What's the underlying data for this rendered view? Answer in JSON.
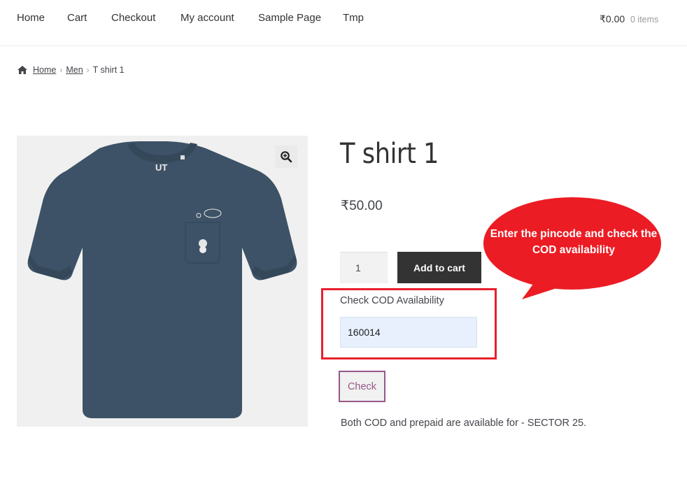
{
  "nav": {
    "items": [
      "Home",
      "Cart",
      "Checkout",
      "My account",
      "Sample Page",
      "Tmp"
    ],
    "cart_total": "₹0.00",
    "cart_count": "0 items"
  },
  "breadcrumb": {
    "home": "Home",
    "category": "Men",
    "current": "T shirt 1",
    "separator": "›"
  },
  "product": {
    "title": "T shirt 1",
    "price": "₹50.00",
    "quantity": "1",
    "add_to_cart_label": "Add to cart",
    "image_logo_text": "UT",
    "shirt_color": "#3d5266"
  },
  "cod": {
    "label": "Check COD Availability",
    "pincode_value": "160014",
    "check_label": "Check",
    "result": "Both COD and prepaid are available for - SECTOR 25."
  },
  "annotation": {
    "callout_text": "Enter the pincode and check the COD availability",
    "highlight_color": "#e8202c"
  },
  "icons": {
    "breadcrumb_home": "home-icon",
    "zoom": "zoom-icon"
  }
}
